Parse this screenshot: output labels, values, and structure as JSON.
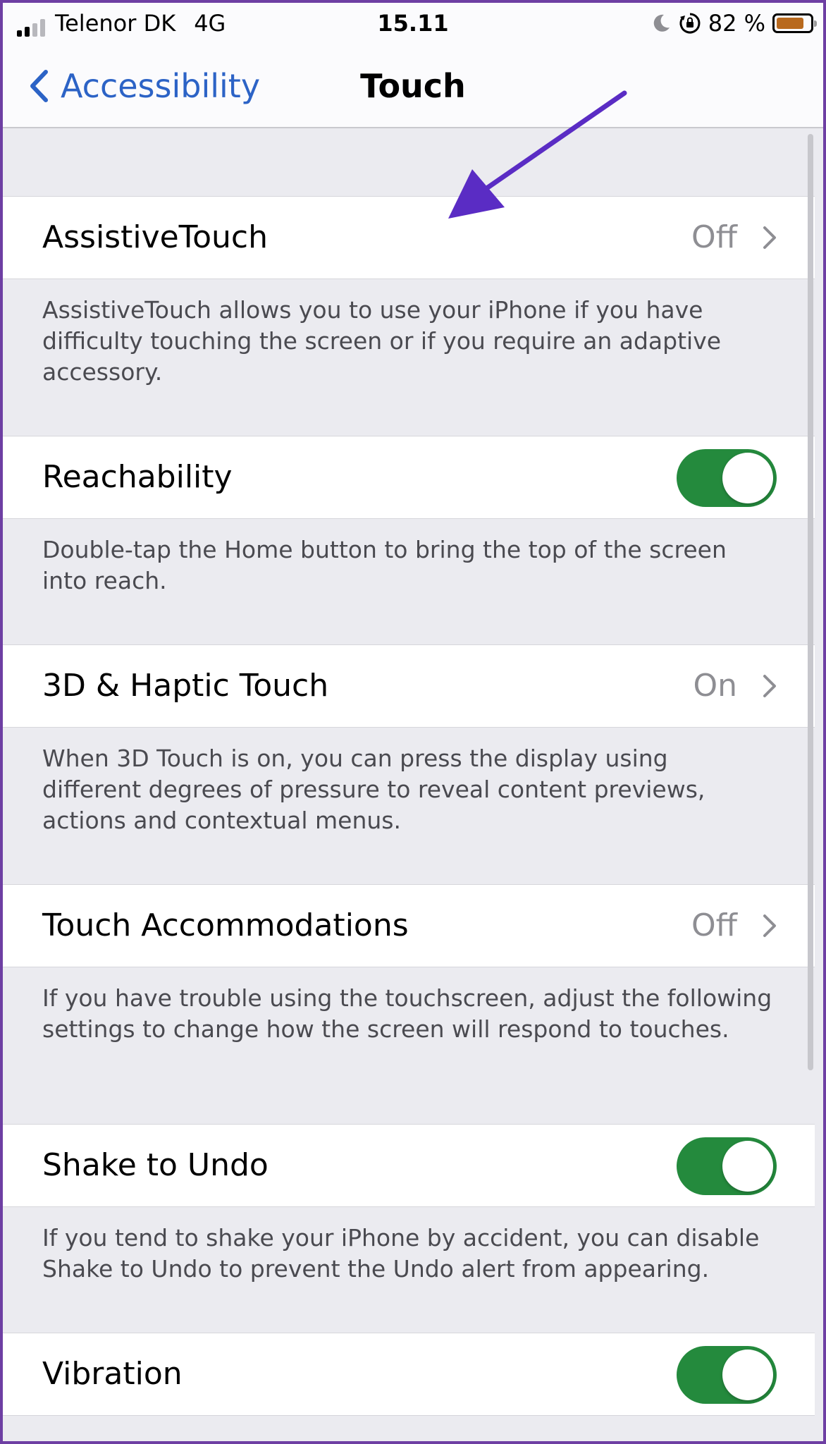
{
  "status_bar": {
    "carrier": "Telenor DK",
    "network": "4G",
    "time": "15.11",
    "battery_percent": "82 %",
    "battery_level": 0.82,
    "signal_bars": 4,
    "signal_active": 2,
    "icons": [
      "moon-icon",
      "orientation-lock-icon",
      "battery-icon"
    ]
  },
  "nav": {
    "back_label": "Accessibility",
    "title": "Touch",
    "accent_color": "#2c63c6"
  },
  "settings": {
    "assistive_touch": {
      "label": "AssistiveTouch",
      "value": "Off",
      "footer": "AssistiveTouch allows you to use your iPhone if you have difficulty touching the screen or if you require an adaptive accessory."
    },
    "reachability": {
      "label": "Reachability",
      "enabled": true,
      "footer": "Double-tap the Home button to bring the top of the screen into reach."
    },
    "haptic_touch": {
      "label": "3D & Haptic Touch",
      "value": "On",
      "footer": "When 3D Touch is on, you can press the display using different degrees of pressure to reveal content previews, actions and contextual menus."
    },
    "touch_accommodations": {
      "label": "Touch Accommodations",
      "value": "Off",
      "footer": "If you have trouble using the touchscreen, adjust the following settings to change how the screen will respond to touches."
    },
    "shake_to_undo": {
      "label": "Shake to Undo",
      "enabled": true,
      "footer": "If you tend to shake your iPhone by accident, you can disable Shake to Undo to prevent the Undo alert from appearing."
    },
    "vibration": {
      "label": "Vibration",
      "enabled": true
    }
  },
  "colors": {
    "toggle_on": "#248a3d",
    "annotation_arrow": "#5a2cc4",
    "frame_border": "#6e3fa3",
    "battery_fill": "#b8691e"
  }
}
